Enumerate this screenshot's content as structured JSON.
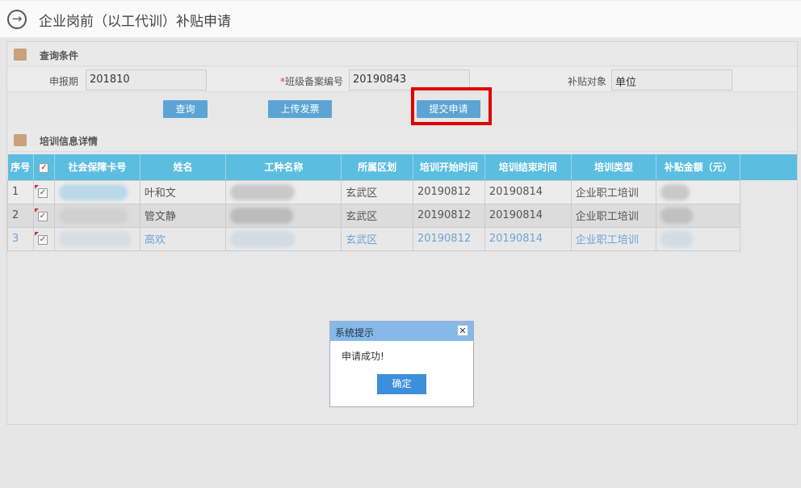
{
  "page_title": "企业岗前（以工代训）补贴申请",
  "query_section": {
    "title": "查询条件",
    "period_label": "申报期",
    "period_value": "201810",
    "class_no_label": "班级备案编号",
    "class_no_required": "*",
    "class_no_value": "20190843",
    "target_label": "补贴对象",
    "target_value": "单位"
  },
  "buttons": {
    "query": "查询",
    "upload_invoice": "上传发票",
    "submit": "提交申请"
  },
  "detail_section": {
    "title": "培训信息详情"
  },
  "table": {
    "headers": [
      "序号",
      "",
      "社会保障卡号",
      "姓名",
      "工种名称",
      "所属区划",
      "培训开始时间",
      "培训结束时间",
      "培训类型",
      "补贴金额（元）"
    ],
    "rows": [
      {
        "no": "1",
        "checked": "✓",
        "name": "叶和文",
        "district": "玄武区",
        "start": "20190812",
        "end": "20190814",
        "type": "企业职工培训"
      },
      {
        "no": "2",
        "checked": "✓",
        "name": "管文静",
        "district": "玄武区",
        "start": "20190812",
        "end": "20190814",
        "type": "企业职工培训"
      },
      {
        "no": "3",
        "checked": "✓",
        "name": "高欢",
        "district": "玄武区",
        "start": "20190812",
        "end": "20190814",
        "type": "企业职工培训"
      }
    ]
  },
  "dialog": {
    "title": "系统提示",
    "message": "申请成功!",
    "ok": "确定",
    "close": "✕"
  },
  "colors": {
    "header": "#5bbde0",
    "button": "#5ba4d4",
    "highlight": "#e00000",
    "dialog_header": "#86b9e8"
  }
}
